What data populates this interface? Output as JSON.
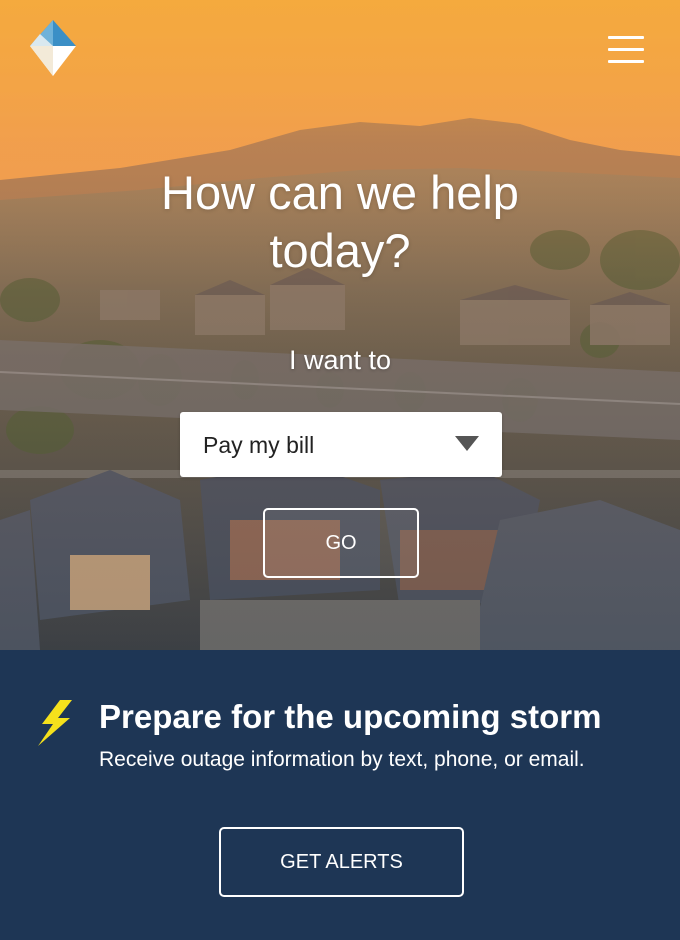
{
  "header": {
    "logo_icon": "diamond-logo-icon",
    "menu_icon": "hamburger-menu-icon"
  },
  "hero": {
    "title": "How can we help today?",
    "want_label": "I want to",
    "select": {
      "value": "Pay my bill",
      "caret_icon": "triangle-down-icon"
    },
    "go_label": "GO"
  },
  "storm": {
    "icon": "lightning-bolt-icon",
    "title": "Prepare for the upcoming storm",
    "subtitle": "Receive outage information by text, phone, or email.",
    "button_label": "GET ALERTS"
  },
  "colors": {
    "banner_background": "#1e3655",
    "bolt": "#f5e11c",
    "logo_blue": "#3b8fc6",
    "hero_sunset": "#f0a64a"
  }
}
